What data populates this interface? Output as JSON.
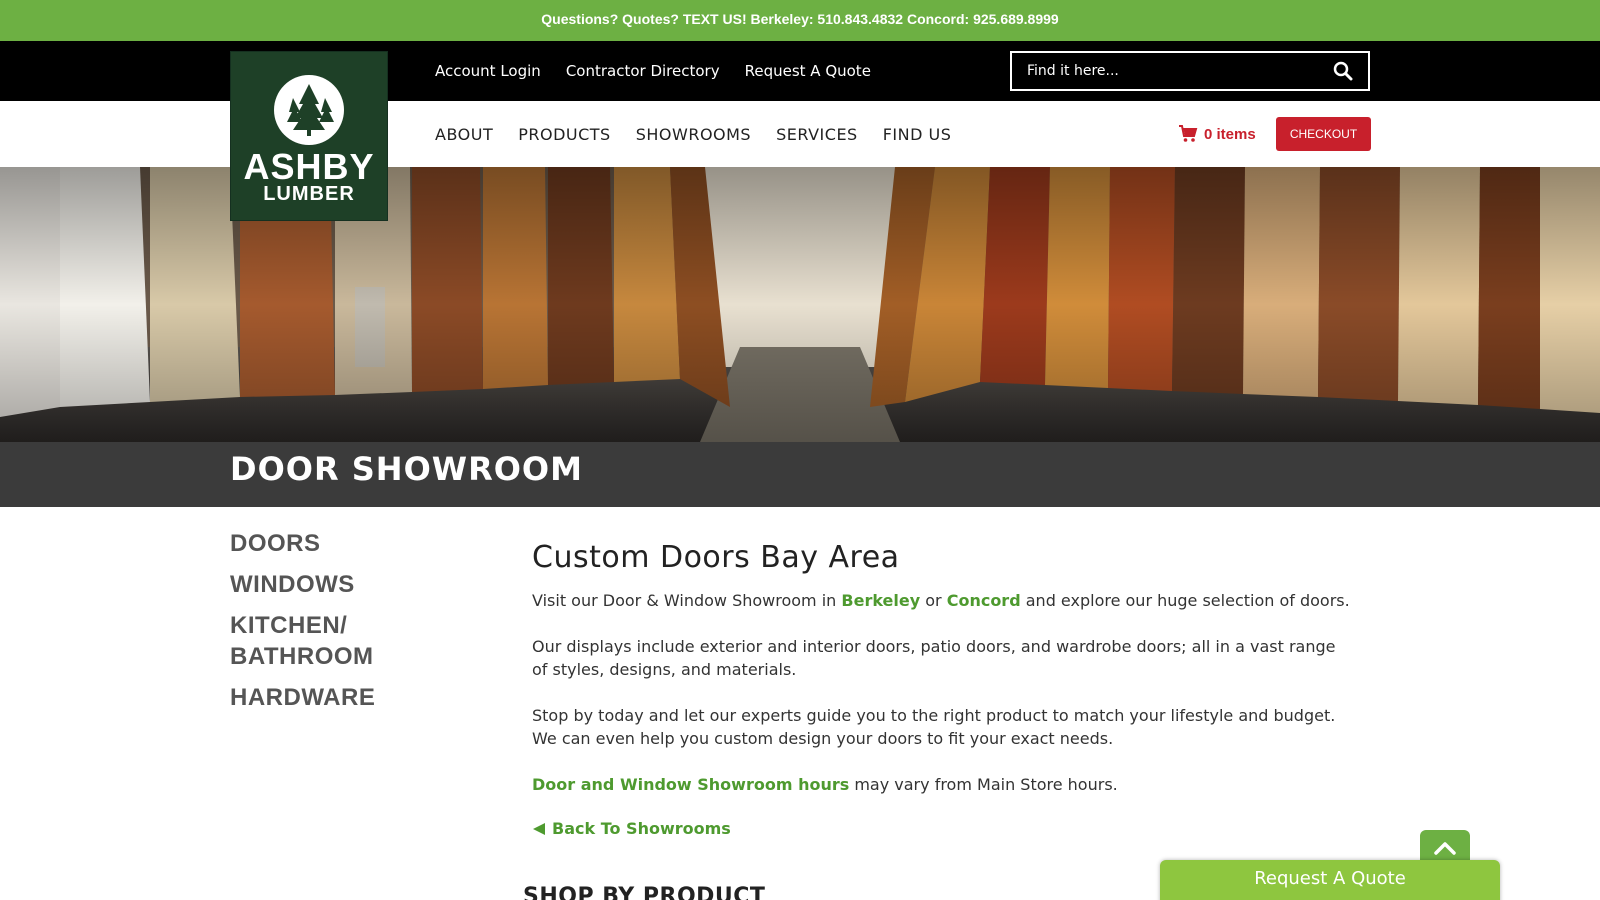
{
  "topbar": {
    "text": "Questions? Quotes? TEXT US! Berkeley: 510.843.4832 Concord: 925.689.8999"
  },
  "util_nav": [
    {
      "label": "Account Login"
    },
    {
      "label": "Contractor Directory"
    },
    {
      "label": "Request A Quote"
    }
  ],
  "search": {
    "placeholder": "Find it here..."
  },
  "main_nav": [
    {
      "label": "ABOUT"
    },
    {
      "label": "PRODUCTS"
    },
    {
      "label": "SHOWROOMS"
    },
    {
      "label": "SERVICES"
    },
    {
      "label": "FIND US"
    }
  ],
  "cart": {
    "label": "0 items"
  },
  "checkout": {
    "label": "CHECKOUT"
  },
  "logo": {
    "line1": "ASHBY",
    "line2": "LUMBER"
  },
  "page_title": "DOOR SHOWROOM",
  "sidenav": [
    {
      "label": "DOORS"
    },
    {
      "label": "WINDOWS"
    },
    {
      "label": "KITCHEN/"
    },
    {
      "label": "BATHROOM"
    },
    {
      "label": "HARDWARE"
    }
  ],
  "content": {
    "heading": "Custom Doors Bay Area",
    "p1_a": "Visit our Door & Window Showroom in ",
    "p1_link1": "Berkeley",
    "p1_b": " or ",
    "p1_link2": "Concord",
    "p1_c": " and explore our huge selection of doors.",
    "p2": "Our displays include exterior and interior doors, patio doors, and wardrobe doors; all in a vast range of styles, designs, and materials.",
    "p3": "Stop by today and let our experts guide you to the right product to match your lifestyle and budget. We can even help you custom design your doors to fit your exact needs.",
    "p4_link": "Door and Window Showroom hours",
    "p4_rest": " may vary from Main Store hours.",
    "back_label": "Back To Showrooms"
  },
  "shop_heading": "SHOP BY PRODUCT",
  "quote_tab": {
    "label": "Request A Quote"
  },
  "colors": {
    "green": "#6db043",
    "red": "#c8202c",
    "dark_green": "#1e4027",
    "title_bar": "#3b3b3b"
  }
}
